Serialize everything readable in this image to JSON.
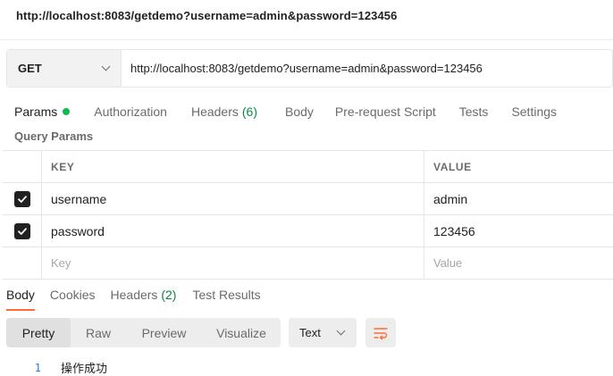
{
  "request_title": "http://localhost:8083/getdemo?username=admin&password=123456",
  "request": {
    "method": "GET",
    "url": "http://localhost:8083/getdemo?username=admin&password=123456"
  },
  "request_tabs": {
    "params": "Params",
    "authorization": "Authorization",
    "headers": "Headers",
    "headers_count": "(6)",
    "body": "Body",
    "prerequest": "Pre-request Script",
    "tests": "Tests",
    "settings": "Settings"
  },
  "query_params": {
    "title": "Query Params",
    "header_key": "KEY",
    "header_value": "VALUE",
    "rows": [
      {
        "key": "username",
        "value": "admin",
        "checked": true
      },
      {
        "key": "password",
        "value": "123456",
        "checked": true
      }
    ],
    "key_placeholder": "Key",
    "value_placeholder": "Value"
  },
  "response_tabs": {
    "body": "Body",
    "cookies": "Cookies",
    "headers": "Headers (2)",
    "test_results": "Test Results"
  },
  "view_modes": {
    "pretty": "Pretty",
    "raw": "Raw",
    "preview": "Preview",
    "visualize": "Visualize"
  },
  "format": "Text",
  "response_body": {
    "line_number": "1",
    "text": "操作成功"
  },
  "colors": {
    "accent": "#ff6c37",
    "status_green": "#0cbb52",
    "line_number": "#2e7bd6"
  }
}
